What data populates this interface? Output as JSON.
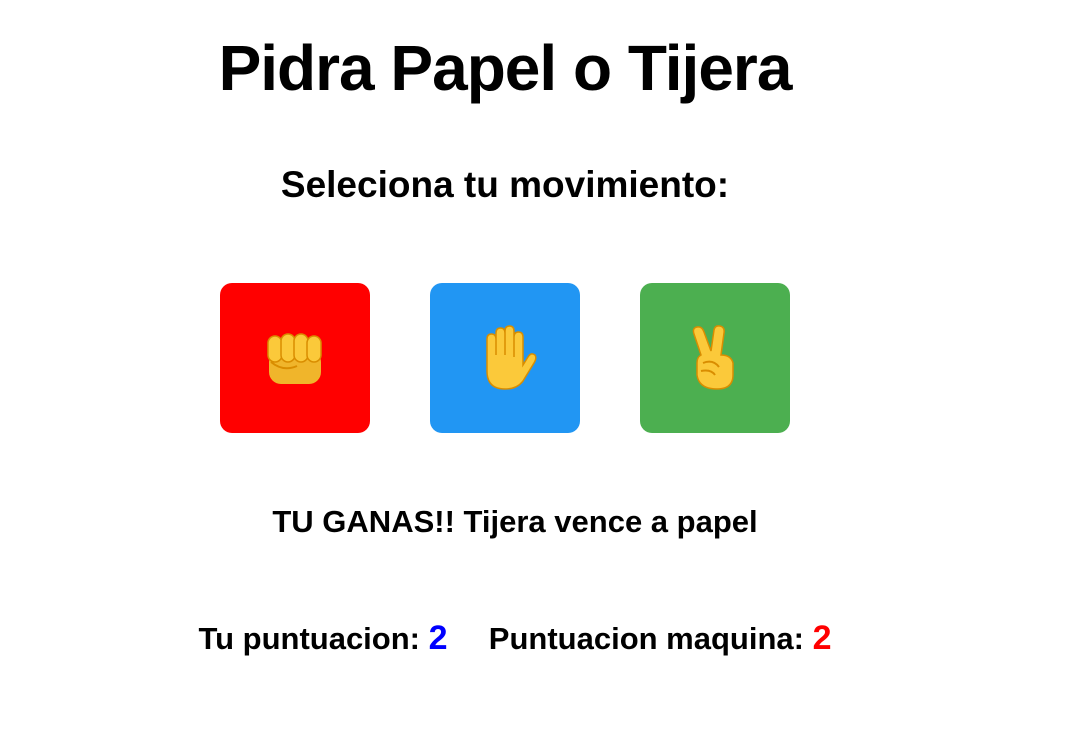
{
  "title": "Pidra Papel o Tijera",
  "subtitle": "Seleciona tu movimiento:",
  "moves": [
    {
      "name": "rock",
      "icon": "fist-icon",
      "color": "#ff0000"
    },
    {
      "name": "paper",
      "icon": "raised-hand-icon",
      "color": "#2196f3"
    },
    {
      "name": "scissors",
      "icon": "victory-hand-icon",
      "color": "#4caf50"
    }
  ],
  "result": "TU GANAS!! Tijera vence a papel",
  "score": {
    "player_label": "Tu puntuacion:",
    "player_value": "2",
    "player_color": "#0000ff",
    "machine_label": "Puntuacion maquina:",
    "machine_value": "2",
    "machine_color": "#ff0000"
  }
}
